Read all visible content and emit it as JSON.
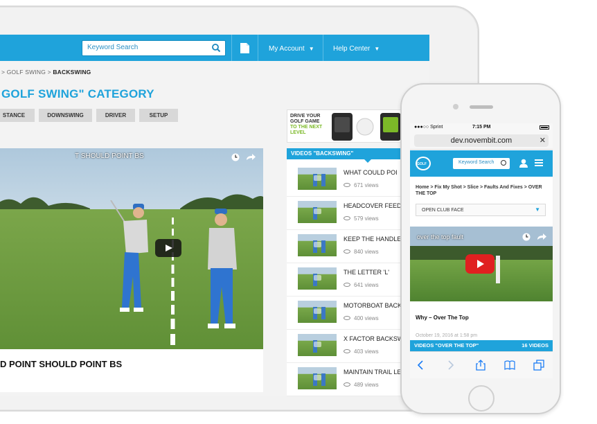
{
  "tablet": {
    "search": {
      "placeholder": "Keyword Search"
    },
    "nav": {
      "my_account": "My Account",
      "help_center": "Help Center"
    },
    "breadcrumb": {
      "part1": "> GOLF SWING >",
      "current": "BACKSWING"
    },
    "heading": "GOLF SWING\" CATEGORY",
    "tabs": [
      "STANCE",
      "DOWNSWING",
      "DRIVER",
      "SETUP"
    ],
    "video": {
      "title": "T SHOULD POINT BS",
      "caption": "D POINT SHOULD POINT BS"
    },
    "ad": {
      "line1": "DRIVE YOUR",
      "line2": "GOLF GAME",
      "line3": "TO THE NEXT",
      "line4": "LEVEL"
    },
    "list": {
      "header": "VIDEOS \"BACKSWING\"",
      "items": [
        {
          "title": "WHAT COULD POI",
          "views": "671 views"
        },
        {
          "title": "HEADCOVER FEED",
          "views": "579 views"
        },
        {
          "title": "KEEP THE HANDLE",
          "views": "840 views"
        },
        {
          "title": "THE LETTER 'L'",
          "views": "641 views"
        },
        {
          "title": "MOTORBOAT BACK",
          "views": "400 views"
        },
        {
          "title": "X FACTOR BACKSW",
          "views": "403 views"
        },
        {
          "title": "MAINTAIN TRAIL LE",
          "views": "489 views"
        }
      ]
    }
  },
  "phone": {
    "status": {
      "carrier": "●●●○○ Sprint",
      "time": "7:15 PM"
    },
    "url": "dev.novembit.com",
    "logo_text": "GOLF",
    "search": {
      "placeholder": "Keyword Search"
    },
    "breadcrumb": "Home > Fix My Shot > Slice > Faults And Fixes > OVER THE TOP",
    "select": {
      "value": "OPEN CLUB FACE"
    },
    "video": {
      "title": "over the top fault",
      "caption": "Why – Over The Top"
    },
    "date": "October 19, 2016 at 1:58 pm",
    "list_header": {
      "left": "VIDEOS \"OVER THE TOP\"",
      "right": "16 VIDEOS"
    }
  },
  "colors": {
    "brand_blue": "#1fa3db",
    "youtube_red": "#e02020"
  },
  "icons": [
    "search-icon",
    "document-icon",
    "chevron-down-icon",
    "clock-icon",
    "share-icon",
    "play-icon",
    "eye-icon",
    "user-icon",
    "menu-icon",
    "close-icon",
    "back-icon",
    "forward-icon",
    "share-icon",
    "bookmarks-icon",
    "tabs-icon"
  ]
}
